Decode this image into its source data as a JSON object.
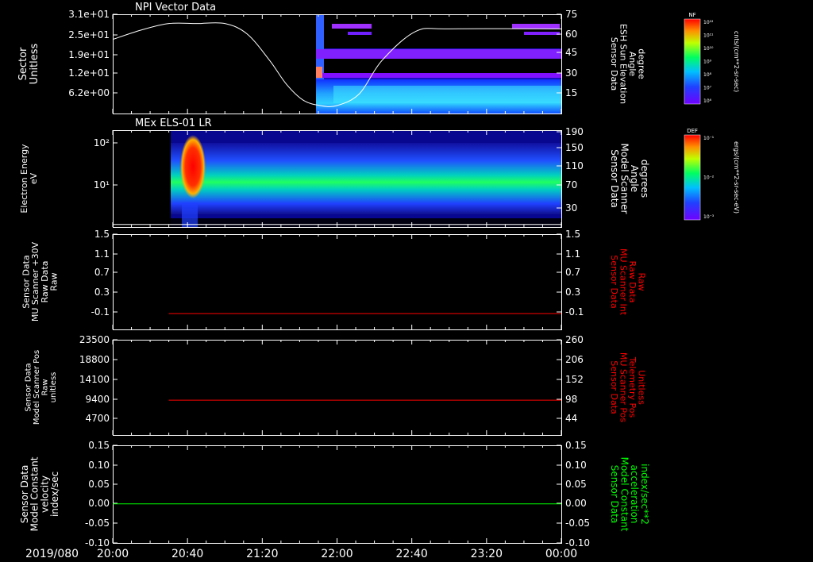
{
  "chart_data": [
    {
      "type": "heatmap",
      "title": "NPI Vector Data",
      "ylabel_left": [
        "Sector",
        "Unitless"
      ],
      "yticks_left": [
        "3.1e+01",
        "2.5e+01",
        "1.9e+01",
        "1.2e+01",
        "6.2e+00"
      ],
      "ylabel_right": [
        "Sensor Data",
        "ESH Sun Elevation",
        "Angle",
        "degree"
      ],
      "yticks_right": [
        "75",
        "60",
        "45",
        "30",
        "15"
      ],
      "ylim_right": [
        0,
        75
      ],
      "series": [
        {
          "name": "ESH Sun Elevation Angle",
          "color": "#ffffff",
          "x_hours": [
            0.0,
            0.25,
            0.5,
            0.75,
            1.0,
            1.2,
            1.4,
            1.55,
            1.7,
            1.85,
            2.0,
            2.2,
            2.4,
            2.7,
            3.0,
            4.0
          ],
          "y": [
            56,
            63,
            68,
            68,
            68,
            60,
            40,
            22,
            10,
            6,
            6,
            15,
            40,
            62,
            64,
            64
          ]
        }
      ],
      "colorbar": {
        "label": "NF",
        "unit": "cnts/(cm**2-sr-sec)",
        "ticks": [
          "10¹²",
          "10¹¹",
          "10¹⁰",
          "10⁹",
          "10⁸",
          "10⁷",
          "10⁶"
        ]
      }
    },
    {
      "type": "heatmap",
      "title": "MEx ELS-01 LR",
      "ylabel_left": [
        "Electron Energy",
        "eV"
      ],
      "yticks_left": [
        "10²",
        "10¹"
      ],
      "ylabel_right": [
        "Sensor Data",
        "Model Scanner",
        "Angle",
        "degrees"
      ],
      "yticks_right": [
        "190",
        "150",
        "110",
        "70",
        "30"
      ],
      "ylim_right": [
        0,
        190
      ],
      "series": [
        {
          "name": "Model Scanner Angle",
          "color": "#ffffff",
          "x_hours": [
            0.0,
            4.0
          ],
          "y": [
            5,
            5
          ]
        }
      ],
      "colorbar": {
        "label": "DEF",
        "unit": "ergs/(cm**2-sr-sec-eV)",
        "ticks": [
          "10⁻¹",
          "10⁻²",
          "10⁻³"
        ]
      }
    },
    {
      "type": "line",
      "ylabel_left": [
        "Sensor Data",
        "MU Scanner +30V",
        "Raw Data",
        "Raw"
      ],
      "yticks_left": [
        "1.5",
        "1.1",
        "0.7",
        "0.3",
        "-0.1"
      ],
      "ylabel_right": [
        "Sensor Data",
        "MU Scanner Int",
        "Raw Data",
        "Raw"
      ],
      "yticks_right": [
        "1.5",
        "1.1",
        "0.7",
        "0.3",
        "-0.1"
      ],
      "ylim": [
        -0.3,
        1.5
      ],
      "series": [
        {
          "name": "MU Scanner Int Raw Data",
          "color": "#ff0000",
          "x_hours": [
            0.5,
            4.0
          ],
          "y": [
            0.0,
            0.0
          ]
        }
      ]
    },
    {
      "type": "line",
      "ylabel_left": [
        "Sensor Data",
        "Model Scanner Pos",
        "Raw",
        "unitless"
      ],
      "yticks_left": [
        "23500",
        "18800",
        "14100",
        "9400",
        "4700"
      ],
      "ylabel_right": [
        "Sensor Data",
        "MU Scanner Pos",
        "Telemetry Pos",
        "Unitless"
      ],
      "yticks_right": [
        "260",
        "206",
        "152",
        "98",
        "44"
      ],
      "ylim": [
        0,
        23500
      ],
      "series": [
        {
          "name": "MU Scanner Pos Telemetry Pos",
          "color": "#ff0000",
          "x_hours": [
            0.5,
            4.0
          ],
          "y": [
            8600,
            8600
          ]
        }
      ]
    },
    {
      "type": "line",
      "ylabel_left": [
        "Sensor Data",
        "Model Constant",
        "velocity",
        "index/sec"
      ],
      "yticks_left": [
        "0.15",
        "0.10",
        "0.05",
        "0.00",
        "-0.05",
        "-0.10"
      ],
      "ylabel_right": [
        "Sensor Data",
        "Model Constant",
        "acceleration",
        "index/sec**2"
      ],
      "yticks_right": [
        "0.15",
        "0.10",
        "0.05",
        "0.00",
        "-0.05",
        "-0.10"
      ],
      "ylim": [
        -0.1,
        0.15
      ],
      "series": [
        {
          "name": "Model Constant acceleration",
          "color": "#00ff00",
          "x_hours": [
            0.0,
            4.0
          ],
          "y": [
            0.0,
            0.0
          ]
        }
      ]
    }
  ],
  "xaxis": {
    "date": "2019/080",
    "ticks": [
      "20:00",
      "20:40",
      "21:20",
      "22:00",
      "22:40",
      "23:20",
      "00:00"
    ],
    "range_hours": [
      0,
      4
    ]
  }
}
